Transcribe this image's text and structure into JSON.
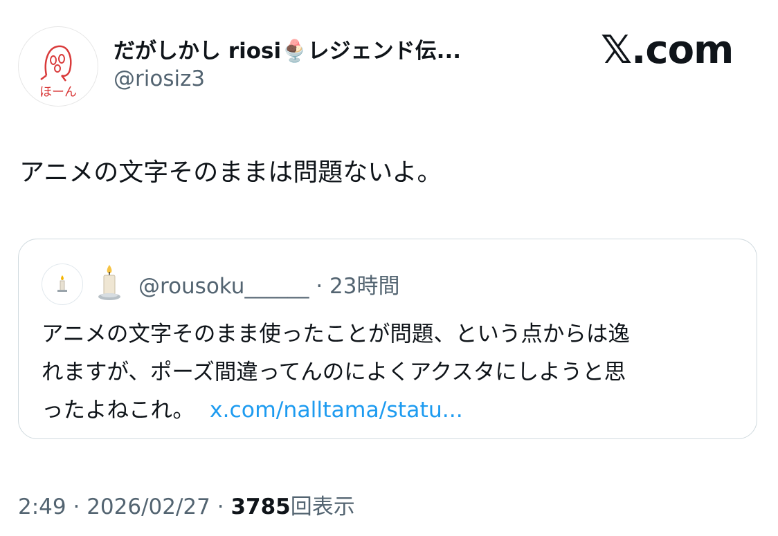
{
  "author": {
    "display_name": "だがしかし riosi🍨レジェンド伝...",
    "handle": "@riosiz3",
    "avatar_text": "ほーん"
  },
  "brand": "𝕏.com",
  "tweet": {
    "text": "アニメの文字そのままは問題ないよ。"
  },
  "quote": {
    "handle": "@rousoku______",
    "separator": "·",
    "time": "23時間",
    "lines": [
      "アニメの文字そのまま使ったことが問題、という点からは逸",
      "れますが、ポーズ間違ってんのによくアクスタにしようと思",
      "ったよねこれ。"
    ],
    "link_text": "x.com/nalltama/statu..."
  },
  "footer": {
    "time": "2:49",
    "separator": "·",
    "date": "2026/02/27",
    "views": "3785",
    "views_label": "回表示"
  },
  "colors": {
    "text": "#0f1419",
    "secondary": "#536471",
    "link": "#1d9bf0",
    "border": "#cfd9de",
    "avatar_sketch": "#d93a3a"
  }
}
